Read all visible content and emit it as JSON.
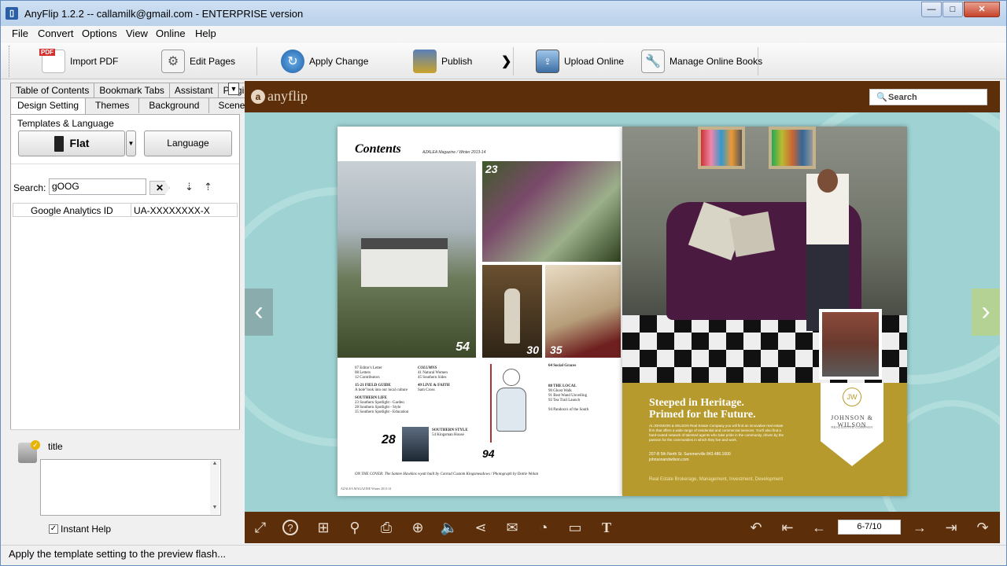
{
  "window": {
    "title": "AnyFlip 1.2.2  -- callamilk@gmail.com - ENTERPRISE version",
    "icon": "anyflip-app-icon",
    "controls": {
      "minimize": "—",
      "maximize": "□",
      "close": "✕"
    }
  },
  "menu": {
    "file": "File",
    "convert": "Convert",
    "options": "Options",
    "view": "View",
    "online": "Online",
    "help": "Help"
  },
  "toolbar": {
    "import_pdf": "Import PDF",
    "edit_pages": "Edit Pages",
    "apply_change": "Apply Change",
    "publish": "Publish",
    "upload_online": "Upload Online",
    "manage_online_books": "Manage Online Books",
    "import_pdf_badge": "PDF"
  },
  "left_panel": {
    "tabs_row1": [
      "Table of Contents",
      "Bookmark Tabs",
      "Assistant",
      "Plugin"
    ],
    "tabs_row2": [
      "Design Setting",
      "Themes",
      "Background",
      "Scenes"
    ],
    "templates_label": "Templates & Language",
    "template_button": "Flat",
    "language_button": "Language",
    "search_label": "Search:",
    "search_value": "gOOG",
    "property_row": {
      "name": "Google Analytics ID",
      "value": "UA-XXXXXXXX-X"
    },
    "help_title": "title",
    "instant_help_label": "Instant Help",
    "instant_help_checked": true
  },
  "status": {
    "text": "Apply the template setting to the preview flash..."
  },
  "preview": {
    "brand": "anyflip",
    "search_placeholder": "Search",
    "page_indicator": "6-7/10",
    "colors": {
      "frame": "#5c2e0a",
      "background": "#9fd3d3",
      "gold": "#b79a2d"
    },
    "left_page": {
      "heading": "Contents",
      "subheading": "AZALEA Magazine / Winter 2013-14",
      "photo_numbers": [
        "23",
        "54",
        "30",
        "35",
        "28",
        "94"
      ],
      "toc_col1": [
        "07 Editor's Letter",
        "08 Letters",
        "12 Contributors",
        "15-21 FIELD GUIDE",
        "A hole\"look into our local culture",
        "SOUTHERN LIFE",
        "23 Southern Spotlight - Garden",
        "28 Southern Spotlight - Style",
        "35 Southern Spotlight - Education"
      ],
      "toc_col2": [
        "COLUMNS",
        "41 Natural Women",
        "45 Southern Sides",
        "49 LIVE & FAITH",
        "Sam Cross",
        "SOUTHERN STYLE",
        "54 Kingsman House"
      ],
      "toc_col3": [
        "64 Social Graces",
        "88 THE LOCAL",
        "90 Ghost Walk",
        "91 Best Wand Unveiling",
        "92 Tea Trail Launch",
        "94 Pandora's of the South"
      ],
      "cover_line": "ON THE COVER: The Santee Hawkins wyatt built by Conrad Custom Kingsmeadows / Photograph by Dottie Wolan",
      "footer": "AZALEA MAGAZINE Winter 2013-14"
    },
    "right_page": {
      "headline_line1": "Steeped in Heritage.",
      "headline_line2": "Primed for the Future.",
      "body": "At JOHNSON & WILSON Real Estate Company you will find an innovative real estate firm that offers a wide range of residential and commercial services. You'll also find a hard-rooted network of talented agents who take pride in the community, driven by the passion for the communities in which they live and work.",
      "address": "207-B 5th North St. Summerville 843.486.1600 johnsonandwilson.com",
      "services": "Real Estate Brokerage, Management, Investment, Development",
      "logo_name": "JOHNSON & WILSON",
      "logo_sub": "REAL ESTATE COMPANY",
      "logo_mark": "JW"
    }
  }
}
